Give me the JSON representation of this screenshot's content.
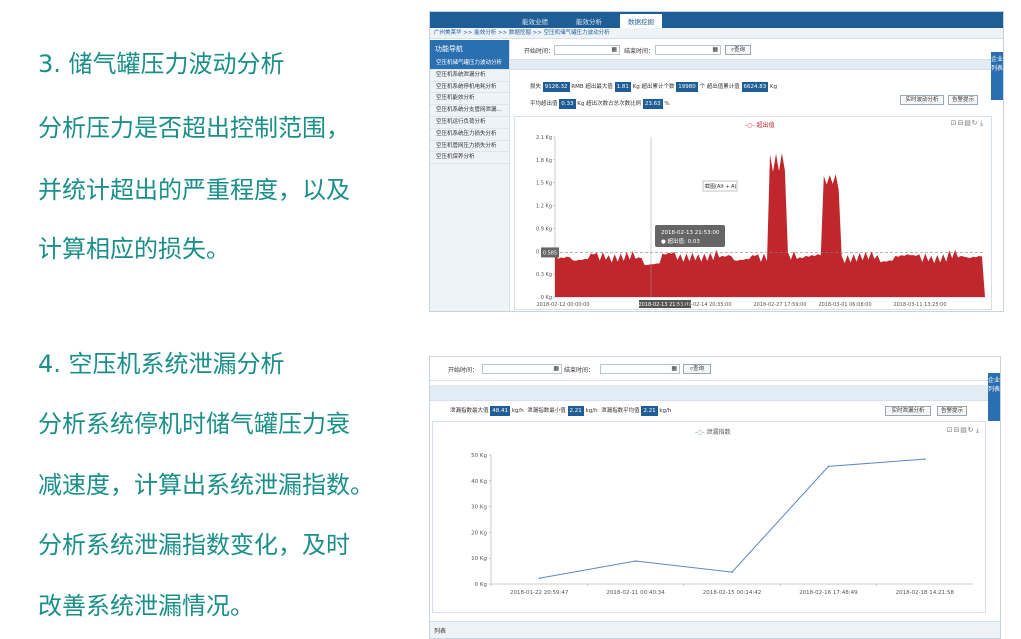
{
  "left_text": {
    "section3_title": "3. 储气罐压力波动分析",
    "section3_line1": "分析压力是否超出控制范围，",
    "section3_line2": "并统计超出的严重程度，以及",
    "section3_line3": "计算相应的损失。",
    "section4_title": "4. 空压机系统泄漏分析",
    "section4_line1": "分析系统停机时储气罐压力衰",
    "section4_line2": "减速度，计算出系统泄漏指数。",
    "section4_line3": "分析系统泄漏指数变化，及时",
    "section4_line4": "改善系统泄漏情况。"
  },
  "shot1": {
    "nav": [
      "能效业绩",
      "能效分析",
      "数据挖掘"
    ],
    "breadcrumb": "广州美莱华 >> 能效分析 >> 数据挖掘 >> 空压机储气罐压力波动分析",
    "sidebar_title": "功能导航",
    "sidebar_items": [
      "空压机储气罐压力波动分析",
      "空压机系统泄漏分析",
      "空压机系统停机电耗分析",
      "空压机能效分析",
      "空压机系统分支管网泄漏...",
      "空压机运行负荷分析",
      "空压机系统压力损失分析",
      "空压机管网压力损失分析",
      "空压机保养分析"
    ],
    "start_label": "开始时间：",
    "end_label": "结束时间：",
    "query_label": "查询",
    "right_tab": "企业列表",
    "stats": {
      "loss_label": "损失",
      "loss_value": "9126.32",
      "loss_unit": "RMB",
      "max_label": "超出最大值",
      "max_value": "1.81",
      "max_unit": "Kg",
      "count_label": "超出累计个数",
      "count_value": "19980",
      "count_unit": "个",
      "sum_label": "超出值累计值",
      "sum_value": "6624.83",
      "sum_unit": "Kg",
      "avg_label": "平均超出值",
      "avg_value": "0.33",
      "avg_unit": "Kg",
      "ratio_label": "超出次数占总次数比例",
      "ratio_value": "23.63",
      "ratio_unit": "%"
    },
    "btn_realtime": "实时波动分析",
    "btn_alarm": "告警提示",
    "legend": "超出值",
    "y_ticks": [
      "2.1 Kg",
      "1.8 Kg",
      "1.5 Kg",
      "1.2 Kg",
      "0.9 Kg",
      "0.6 Kg",
      "0.3 Kg",
      "0 Kg"
    ],
    "x_ticks": [
      "2018-02-12 00:00:00",
      "2018-02-13 21:53:00",
      "2018-02-14 20:35:00",
      "2018-02-27 17:59:00",
      "2018-03-01 06:08:00",
      "2018-03-11 13:25:00"
    ],
    "markline_label": "0.585",
    "tooltip_time": "2018-02-13 21:53:00",
    "tooltip_value": "超出值: 0.03",
    "screenshot_hint": "截图(Alt + A)"
  },
  "shot2": {
    "start_label": "开始时间：",
    "end_label": "结束时间：",
    "query_label": "查询",
    "right_tab": "企业列表",
    "stats": {
      "max_label": "泄漏指数最大值",
      "max_value": "48.41",
      "max_unit": "kg/h",
      "min_label": "泄漏指数最小值",
      "min_value": "2.21",
      "min_unit": "kg/h",
      "avg_label": "泄漏指数平均值",
      "avg_value": "2.21",
      "avg_unit": "kg/h"
    },
    "btn_realtime": "实时泄漏分析",
    "btn_alarm": "告警提示",
    "list_label": "列表"
  },
  "chart_data": [
    {
      "type": "area",
      "title": "",
      "series": [
        {
          "name": "超出值",
          "values": [
            0.6,
            0.55,
            0.62,
            0.58,
            0.6,
            0.5,
            0.63,
            0.6,
            0.58,
            0.62,
            0.55,
            0.6,
            1.9,
            0.6,
            0.62,
            1.65,
            0.58,
            0.6,
            0.55,
            0.61,
            0.6,
            0.57,
            0.62,
            0.6
          ]
        }
      ],
      "ylim": [
        0,
        2.1
      ],
      "markline": 0.585,
      "color": "#c0272d"
    },
    {
      "type": "line",
      "title": "",
      "categories": [
        "2018-01-22 20:59:47",
        "2018-02-11 00:40:34",
        "2018-02-15 00:14:42",
        "2018-02-16 17:48:49",
        "2018-02-18 14:21:58"
      ],
      "series": [
        {
          "name": "泄漏指数",
          "values": [
            2.21,
            8.9,
            4.6,
            45.6,
            48.41
          ]
        }
      ],
      "y_ticks": [
        "50 Kg",
        "40 Kg",
        "30 Kg",
        "20 Kg",
        "10 Kg",
        "0 Kg"
      ],
      "ylim": [
        0,
        50
      ],
      "color": "#5b86c5"
    }
  ]
}
